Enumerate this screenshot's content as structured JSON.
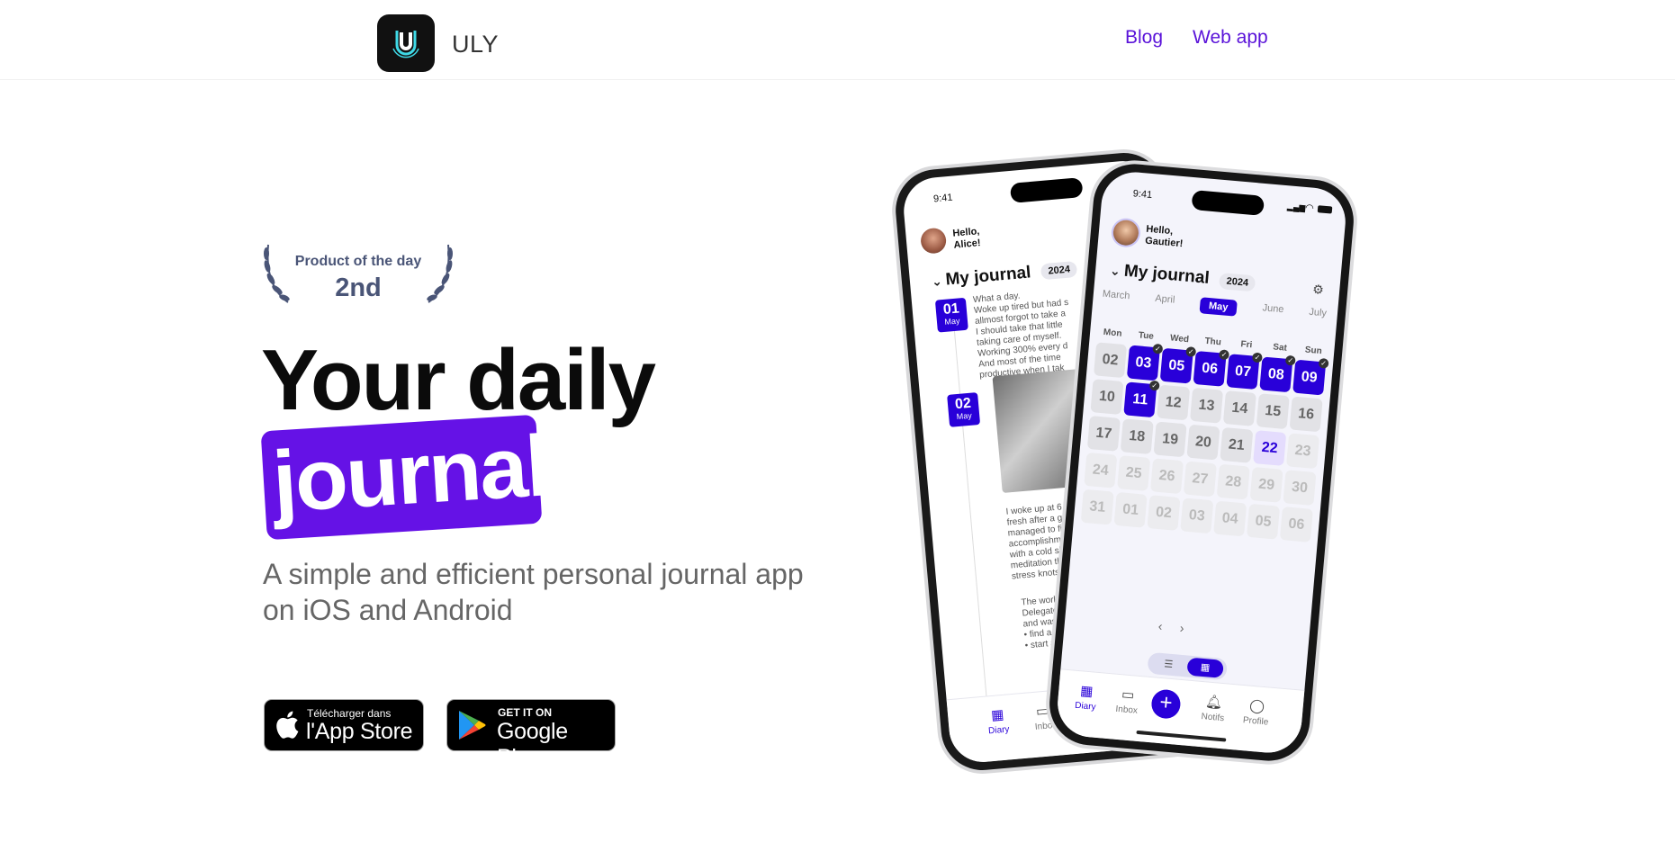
{
  "header": {
    "brand": "ULY",
    "logo_icon": "uly-logo-icon",
    "nav": [
      {
        "label": "Blog"
      },
      {
        "label": "Web app"
      }
    ]
  },
  "badge": {
    "top": "Product of the day",
    "rank": "2nd"
  },
  "hero": {
    "line1": "Your daily",
    "line2": "journal",
    "subtitle": "A simple and efficient personal journal app on iOS and Android"
  },
  "stores": {
    "apple": {
      "small": "Télécharger dans",
      "big": "l'App Store",
      "icon": "apple-icon"
    },
    "google": {
      "small": "GET IT ON",
      "big": "Google Play",
      "icon": "google-play-icon"
    }
  },
  "phone_back": {
    "time": "9:41",
    "greeting_1": "Hello,",
    "greeting_2": "Alice!",
    "title": "My journal",
    "year": "2024",
    "entries": [
      {
        "day": "01",
        "month": "May",
        "text": "What a day.\nWoke up tired but had s\nallmost forgot to take a\nI should take that little\ntaking care of myself.\nWorking 300% every d\nAnd most of the time\nproductive when I tak"
      },
      {
        "day": "02",
        "month": "May",
        "text": "I woke up at 6 a\nfresh after a go\nmanaged to fini\naccomplishme\nwith a cold sh\nmeditation th\nstress knots"
      }
    ],
    "entry3": "The work f\nDelegate\nand was a\n• find a\n• start a",
    "tabs": [
      "Diary",
      "Inbo"
    ]
  },
  "phone_front": {
    "time": "9:41",
    "greeting_1": "Hello,",
    "greeting_2": "Gautier!",
    "title": "My journal",
    "year": "2024",
    "months": [
      "March",
      "April",
      "May",
      "June",
      "July"
    ],
    "active_month": "May",
    "weekdays": [
      "Mon",
      "Tue",
      "Wed",
      "Thu",
      "Fri",
      "Sat",
      "Sun"
    ],
    "days": [
      {
        "n": "02",
        "s": "past"
      },
      {
        "n": "03",
        "s": "done"
      },
      {
        "n": "05",
        "s": "done"
      },
      {
        "n": "06",
        "s": "done"
      },
      {
        "n": "07",
        "s": "done"
      },
      {
        "n": "08",
        "s": "done"
      },
      {
        "n": "09",
        "s": "done"
      },
      {
        "n": "10",
        "s": "past"
      },
      {
        "n": "11",
        "s": "done"
      },
      {
        "n": "12",
        "s": "past"
      },
      {
        "n": "13",
        "s": "past"
      },
      {
        "n": "14",
        "s": "past"
      },
      {
        "n": "15",
        "s": "past"
      },
      {
        "n": "16",
        "s": "past"
      },
      {
        "n": "17",
        "s": "past"
      },
      {
        "n": "18",
        "s": "past"
      },
      {
        "n": "19",
        "s": "past"
      },
      {
        "n": "20",
        "s": "past"
      },
      {
        "n": "21",
        "s": "past"
      },
      {
        "n": "22",
        "s": "today"
      },
      {
        "n": "23",
        "s": "future"
      },
      {
        "n": "24",
        "s": "future"
      },
      {
        "n": "25",
        "s": "future"
      },
      {
        "n": "26",
        "s": "future"
      },
      {
        "n": "27",
        "s": "future"
      },
      {
        "n": "28",
        "s": "future"
      },
      {
        "n": "29",
        "s": "future"
      },
      {
        "n": "30",
        "s": "future"
      },
      {
        "n": "31",
        "s": "future"
      },
      {
        "n": "01",
        "s": "future"
      },
      {
        "n": "02",
        "s": "future"
      },
      {
        "n": "03",
        "s": "future"
      },
      {
        "n": "04",
        "s": "future"
      },
      {
        "n": "05",
        "s": "future"
      },
      {
        "n": "06",
        "s": "future"
      }
    ],
    "tabs": [
      {
        "label": "Diary",
        "icon": "calendar-icon"
      },
      {
        "label": "Inbox",
        "icon": "inbox-icon"
      },
      {
        "label": "Notifs",
        "icon": "bell-icon"
      },
      {
        "label": "Profile",
        "icon": "user-icon"
      }
    ]
  },
  "colors": {
    "accent": "#6512e6",
    "link": "#5a13d9",
    "app_primary": "#2900d9",
    "badge": "#4a5577"
  }
}
